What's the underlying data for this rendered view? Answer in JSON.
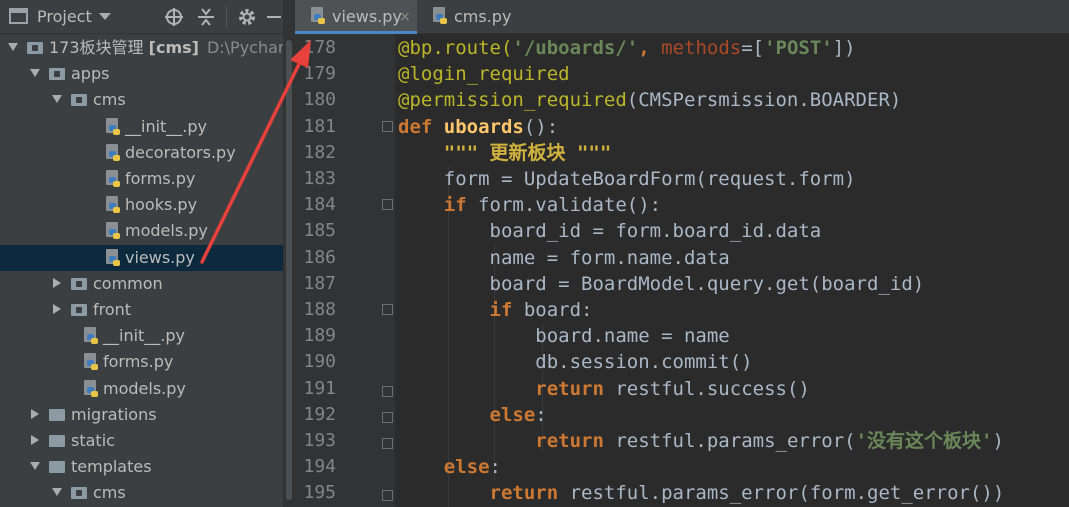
{
  "project_panel": {
    "title": "Project",
    "tree": [
      {
        "label": "173板块管理",
        "bold": "[cms]",
        "path": "D:\\PycharmPro",
        "depth": 0,
        "expanded": true,
        "type": "project"
      },
      {
        "label": "apps",
        "depth": 1,
        "expanded": true,
        "type": "package"
      },
      {
        "label": "cms",
        "depth": 2,
        "expanded": true,
        "type": "package"
      },
      {
        "label": "__init__.py",
        "depth": 3,
        "type": "py"
      },
      {
        "label": "decorators.py",
        "depth": 3,
        "type": "py"
      },
      {
        "label": "forms.py",
        "depth": 3,
        "type": "py"
      },
      {
        "label": "hooks.py",
        "depth": 3,
        "type": "py"
      },
      {
        "label": "models.py",
        "depth": 3,
        "type": "py"
      },
      {
        "label": "views.py",
        "depth": 3,
        "type": "py",
        "selected": true
      },
      {
        "label": "common",
        "depth": 2,
        "expanded": false,
        "type": "package"
      },
      {
        "label": "front",
        "depth": 2,
        "expanded": false,
        "type": "package"
      },
      {
        "label": "__init__.py",
        "depth": 2,
        "type": "py"
      },
      {
        "label": "forms.py",
        "depth": 2,
        "type": "py"
      },
      {
        "label": "models.py",
        "depth": 2,
        "type": "py"
      },
      {
        "label": "migrations",
        "depth": 1,
        "expanded": false,
        "type": "folder"
      },
      {
        "label": "static",
        "depth": 1,
        "expanded": false,
        "type": "folder"
      },
      {
        "label": "templates",
        "depth": 1,
        "expanded": true,
        "type": "folder"
      },
      {
        "label": "cms",
        "depth": 2,
        "expanded": true,
        "type": "package"
      }
    ]
  },
  "tabs": [
    {
      "label": "views.py",
      "active": true,
      "close": "×"
    },
    {
      "label": "cms.py",
      "active": false
    }
  ],
  "editor": {
    "line_numbers": [
      "178",
      "179",
      "180",
      "181",
      "182",
      "183",
      "184",
      "185",
      "186",
      "187",
      "188",
      "189",
      "190",
      "191",
      "192",
      "193",
      "194",
      "195"
    ],
    "code_lines": [
      [
        {
          "t": "@bp.route(",
          "c": "dec"
        },
        {
          "t": "'/uboards/'",
          "c": "str"
        },
        {
          "t": ", ",
          "c": "kw"
        },
        {
          "t": "methods",
          "c": "par"
        },
        {
          "t": "=[",
          "c": "txt"
        },
        {
          "t": "'POST'",
          "c": "str"
        },
        {
          "t": "])",
          "c": "txt"
        }
      ],
      [
        {
          "t": "@login_required",
          "c": "dec"
        }
      ],
      [
        {
          "t": "@permission_required",
          "c": "dec"
        },
        {
          "t": "(CMSPersmission.BOARDER)",
          "c": "txt"
        }
      ],
      [
        {
          "t": "def ",
          "c": "kw"
        },
        {
          "t": "uboards",
          "c": "fn"
        },
        {
          "t": "():",
          "c": "txt"
        }
      ],
      [
        {
          "t": "    \"\"\" 更新板块 \"\"\"",
          "c": "doc"
        }
      ],
      [
        {
          "t": "    form = UpdateBoardForm(request.form)",
          "c": "txt"
        }
      ],
      [
        {
          "t": "    ",
          "c": "txt"
        },
        {
          "t": "if ",
          "c": "kw"
        },
        {
          "t": "form.validate():",
          "c": "txt"
        }
      ],
      [
        {
          "t": "        board_id = form.board_id.data",
          "c": "txt"
        }
      ],
      [
        {
          "t": "        name = form.name.data",
          "c": "txt"
        }
      ],
      [
        {
          "t": "        board = BoardModel.query.get(board_id)",
          "c": "txt"
        }
      ],
      [
        {
          "t": "        ",
          "c": "txt"
        },
        {
          "t": "if ",
          "c": "kw"
        },
        {
          "t": "board:",
          "c": "txt"
        }
      ],
      [
        {
          "t": "            board.name = name",
          "c": "txt"
        }
      ],
      [
        {
          "t": "            db.session.commit()",
          "c": "txt"
        }
      ],
      [
        {
          "t": "            ",
          "c": "txt"
        },
        {
          "t": "return ",
          "c": "kw"
        },
        {
          "t": "restful.success()",
          "c": "txt"
        }
      ],
      [
        {
          "t": "        ",
          "c": "txt"
        },
        {
          "t": "else",
          "c": "kw"
        },
        {
          "t": ":",
          "c": "txt"
        }
      ],
      [
        {
          "t": "            ",
          "c": "txt"
        },
        {
          "t": "return ",
          "c": "kw"
        },
        {
          "t": "restful.params_error(",
          "c": "txt"
        },
        {
          "t": "'没有这个板块'",
          "c": "str"
        },
        {
          "t": ")",
          "c": "txt"
        }
      ],
      [
        {
          "t": "    ",
          "c": "txt"
        },
        {
          "t": "else",
          "c": "kw"
        },
        {
          "t": ":",
          "c": "txt"
        }
      ],
      [
        {
          "t": "        ",
          "c": "txt"
        },
        {
          "t": "return ",
          "c": "kw"
        },
        {
          "t": "restful.params_error(form.get_error())",
          "c": "txt"
        }
      ]
    ]
  },
  "colors": {
    "background": "#2b2b2b",
    "panel": "#3c3f41",
    "selection": "#0d293e",
    "annotation_arrow": "#e8403a"
  },
  "icons": [
    "dropdown-caret-icon",
    "locate-icon",
    "collapse-icon",
    "gear-icon",
    "minimize-icon",
    "python-file-icon",
    "folder-icon",
    "package-icon"
  ]
}
